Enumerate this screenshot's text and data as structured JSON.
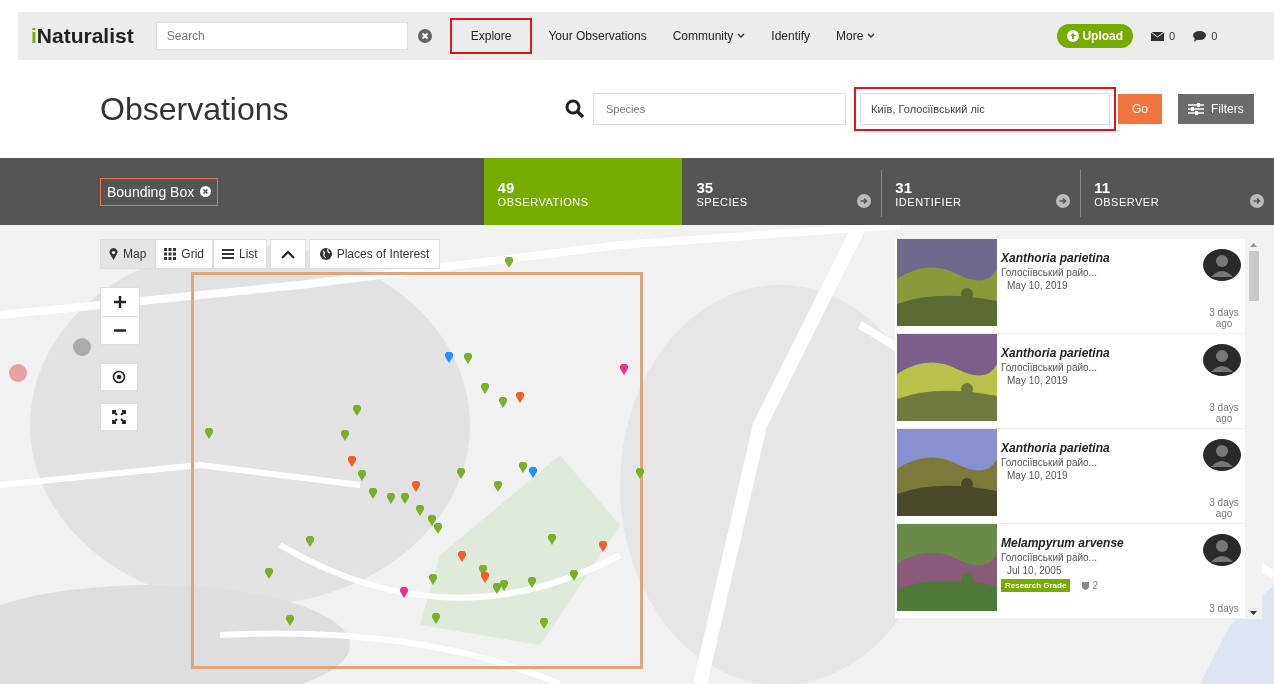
{
  "header": {
    "logo": "iNaturalist",
    "search": {
      "placeholder": "Search"
    },
    "nav": [
      {
        "label": "Explore",
        "dropdown": false,
        "highlighted": true
      },
      {
        "label": "Your Observations",
        "dropdown": false,
        "highlighted": false
      },
      {
        "label": "Community",
        "dropdown": true,
        "highlighted": false
      },
      {
        "label": "Identify",
        "dropdown": false,
        "highlighted": false
      },
      {
        "label": "More",
        "dropdown": true,
        "highlighted": false
      }
    ],
    "upload": "Upload",
    "messages": "0",
    "notifications": "0"
  },
  "title": "Observations",
  "species_search": {
    "placeholder": "Species"
  },
  "place_search": {
    "value": "Київ, Голосіївський ліс",
    "highlighted": true
  },
  "go": "Go",
  "filters": "Filters",
  "filter_chip": "Bounding Box",
  "stats": [
    {
      "count": "49",
      "label": "OBSERVATIONS",
      "selected": true
    },
    {
      "count": "35",
      "label": "SPECIES",
      "selected": false
    },
    {
      "count": "31",
      "label": "IDENTIFIER",
      "selected": false
    },
    {
      "count": "11",
      "label": "OBSERVER",
      "selected": false
    }
  ],
  "view_tabs": [
    {
      "label": "Map",
      "selected": true
    },
    {
      "label": "Grid",
      "selected": false
    },
    {
      "label": "List",
      "selected": false
    }
  ],
  "places_of_interest": "Places of Interest",
  "map_pins": [
    {
      "color": "#7ab029"
    },
    {
      "color": "#7ab029"
    },
    {
      "color": "#7ab029"
    },
    {
      "color": "#7ab029"
    },
    {
      "color": "#7ab029"
    },
    {
      "color": "#7ab029"
    },
    {
      "color": "#7ab029"
    },
    {
      "color": "#7ab029"
    },
    {
      "color": "#7ab029"
    },
    {
      "color": "#7ab029"
    },
    {
      "color": "#7ab029"
    },
    {
      "color": "#7ab029"
    },
    {
      "color": "#7ab029"
    },
    {
      "color": "#7ab029"
    },
    {
      "color": "#7ab029"
    },
    {
      "color": "#7ab029"
    },
    {
      "color": "#7ab029"
    },
    {
      "color": "#7ab029"
    },
    {
      "color": "#7ab029"
    },
    {
      "color": "#7ab029"
    },
    {
      "color": "#7ab029"
    },
    {
      "color": "#7ab029"
    },
    {
      "color": "#7ab029"
    },
    {
      "color": "#7ab029"
    },
    {
      "color": "#7ab029"
    },
    {
      "color": "#7ab029"
    },
    {
      "color": "#7ab029"
    },
    {
      "color": "#7ab029"
    },
    {
      "color": "#7ab029"
    },
    {
      "color": "#7ab029"
    },
    {
      "color": "#f1602b"
    },
    {
      "color": "#f1602b"
    },
    {
      "color": "#f1602b"
    },
    {
      "color": "#f1602b"
    },
    {
      "color": "#f1602b"
    },
    {
      "color": "#f1602b"
    },
    {
      "color": "#1e90ff"
    },
    {
      "color": "#1e90ff"
    },
    {
      "color": "#e9318f"
    },
    {
      "color": "#e9318f"
    }
  ],
  "observations": [
    {
      "name": "Xanthoria parietina",
      "place": "Голосіївський райо...",
      "date": "May 10, 2019",
      "time_ago": "3 days ago"
    },
    {
      "name": "Xanthoria parietina",
      "place": "Голосіївський райо...",
      "date": "May 10, 2019",
      "time_ago": "3 days ago"
    },
    {
      "name": "Xanthoria parietina",
      "place": "Голосіївський райо...",
      "date": "May 10, 2019",
      "time_ago": "3 days ago"
    },
    {
      "name": "Melampyrum arvense",
      "place": "Голосіївський райо...",
      "date": "Jul 10, 2005",
      "time_ago": "3 days",
      "badge": "Research Grade",
      "id_count": "2"
    }
  ]
}
